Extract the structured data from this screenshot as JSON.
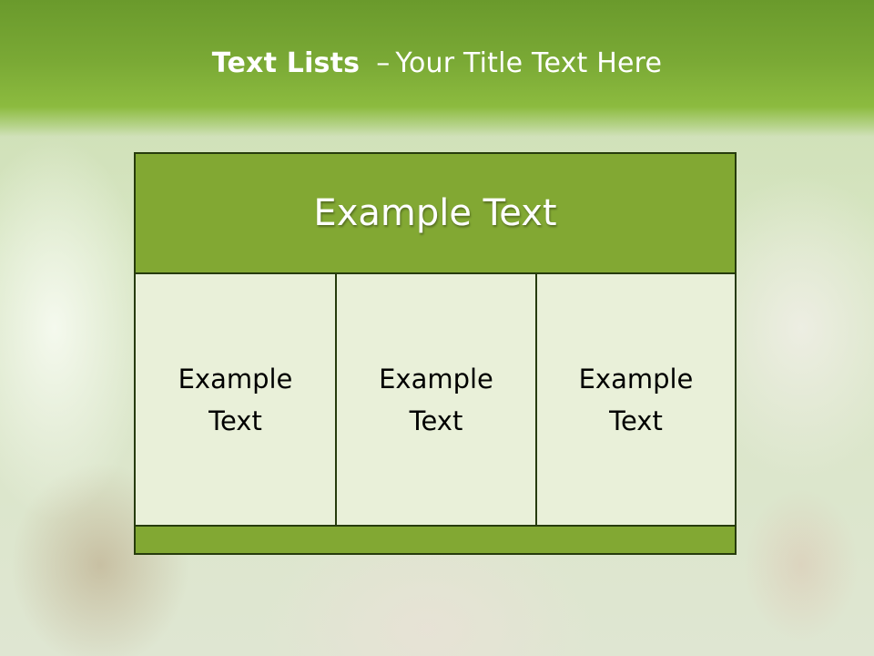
{
  "slide": {
    "title_bold": "Text Lists",
    "title_separator": "–",
    "title_rest": "Your Title Text Here"
  },
  "table": {
    "header": "Example Text",
    "cells": [
      "Example Text",
      "Example Text",
      "Example Text"
    ]
  },
  "colors": {
    "header_band": "#7aa935",
    "table_header_fill": "#82a833",
    "table_cell_fill": "#e9f0d9",
    "table_border": "#263b0c",
    "title_text": "#ffffff"
  }
}
